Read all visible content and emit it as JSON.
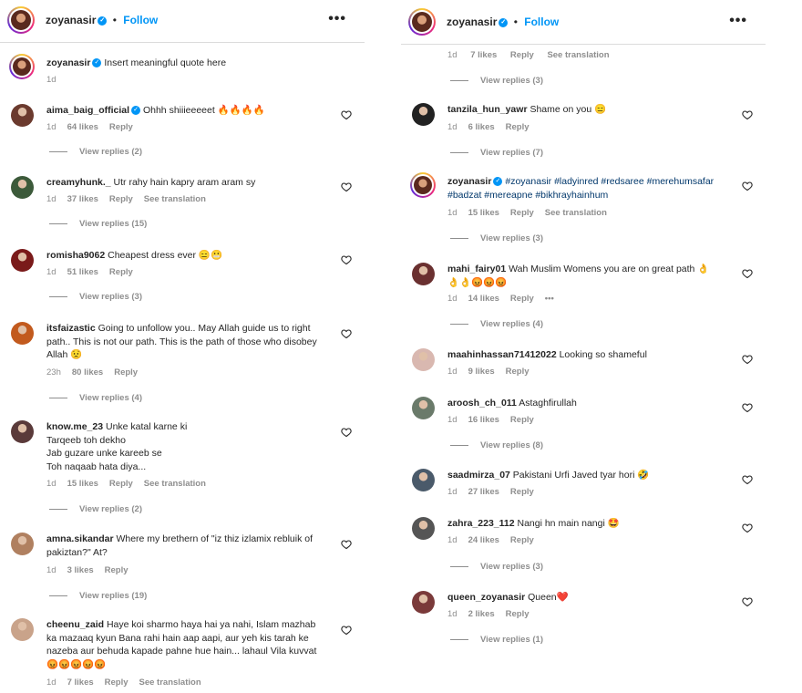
{
  "left": {
    "header": {
      "username": "zoyanasir",
      "dot": "•",
      "follow": "Follow"
    },
    "caption": {
      "username": "zoyanasir",
      "text": "Insert meaningful quote here",
      "time": "1d"
    },
    "comments": [
      {
        "user": "aima_baig_official",
        "verified": true,
        "text": "Ohhh shiiieeeeet 🔥🔥🔥🔥",
        "time": "1d",
        "likes": "64 likes",
        "reply": "Reply",
        "translation": "",
        "view_replies": "View replies (2)",
        "avatar_color": "#6b3a2e"
      },
      {
        "user": "creamyhunk._",
        "text": "Utr rahy hain kapry aram aram sy",
        "time": "1d",
        "likes": "37 likes",
        "reply": "Reply",
        "translation": "See translation",
        "view_replies": "View replies (15)",
        "avatar_color": "#3c5a3a"
      },
      {
        "user": "romisha9062",
        "text": "Cheapest dress ever 😑😬",
        "time": "1d",
        "likes": "51 likes",
        "reply": "Reply",
        "translation": "",
        "view_replies": "View replies (3)",
        "avatar_color": "#7a1a1a"
      },
      {
        "user": "itsfaizastic",
        "text": "Going to unfollow you.. May Allah guide us to right path.. This is not our path. This is the path of those who disobey Allah 😟",
        "time": "23h",
        "likes": "80 likes",
        "reply": "Reply",
        "translation": "",
        "view_replies": "View replies (4)",
        "avatar_color": "#c25a1e"
      },
      {
        "user": "know.me_23",
        "text": "Unke katal karne ki\nTarqeeb toh dekho\nJab guzare unke kareeb se\nToh naqaab hata diya...",
        "time": "1d",
        "likes": "15 likes",
        "reply": "Reply",
        "translation": "See translation",
        "view_replies": "View replies (2)",
        "avatar_color": "#5a3a3a"
      },
      {
        "user": "amna.sikandar",
        "text": "Where my brethern of \"iz thiz izlamix rebluik of pakiztan?\" At?",
        "time": "1d",
        "likes": "3 likes",
        "reply": "Reply",
        "translation": "",
        "view_replies": "View replies (19)",
        "avatar_color": "#b08060"
      },
      {
        "user": "cheenu_zaid",
        "text": "Haye koi sharmo haya hai ya nahi, Islam mazhab ka mazaaq kyun Bana rahi hain aap aapi, aur yeh kis tarah ke nazeba aur behuda kapade pahne hue hain... lahaul Vila kuvvat 😡😡😡😡😡",
        "time": "1d",
        "likes": "7 likes",
        "reply": "Reply",
        "translation": "See translation",
        "view_replies": "",
        "avatar_color": "#c9a38a"
      }
    ]
  },
  "right": {
    "header": {
      "username": "zoyanasir",
      "dot": "•",
      "follow": "Follow"
    },
    "top_meta": {
      "time": "1d",
      "likes": "7 likes",
      "reply": "Reply",
      "translation": "See translation",
      "view_replies": "View replies (3)"
    },
    "comments": [
      {
        "user": "tanzila_hun_yawr",
        "text": "Shame on you 😑",
        "time": "1d",
        "likes": "6 likes",
        "reply": "Reply",
        "translation": "",
        "view_replies": "View replies (7)",
        "avatar_color": "#222222"
      },
      {
        "user": "zoyanasir",
        "verified": true,
        "text": "#zoyanasir #ladyinred #redsaree #merehumsafar #badzat #mereapne #bikhrayhainhum",
        "time": "1d",
        "likes": "15 likes",
        "reply": "Reply",
        "translation": "See translation",
        "view_replies": "View replies (3)",
        "avatar_color": "ring"
      },
      {
        "user": "mahi_fairy01",
        "text": "Wah Muslim Womens you are on great path 👌👌👌😡😡😡",
        "time": "1d",
        "likes": "14 likes",
        "reply": "Reply",
        "translation": "",
        "more": "•••",
        "view_replies": "View replies (4)",
        "avatar_color": "#6a3030"
      },
      {
        "user": "maahinhassan71412022",
        "text": "Looking so shameful",
        "time": "1d",
        "likes": "9 likes",
        "reply": "Reply",
        "translation": "",
        "view_replies": "",
        "avatar_color": "#d9b8b0"
      },
      {
        "user": "aroosh_ch_011",
        "text": "Astaghfirullah",
        "time": "1d",
        "likes": "16 likes",
        "reply": "Reply",
        "translation": "",
        "view_replies": "View replies (8)",
        "avatar_color": "#6a7a6a"
      },
      {
        "user": "saadmirza_07",
        "text": "Pakistani Urfi Javed tyar hori 🤣",
        "time": "1d",
        "likes": "27 likes",
        "reply": "Reply",
        "translation": "",
        "view_replies": "",
        "avatar_color": "#4a5a6a"
      },
      {
        "user": "zahra_223_112",
        "text": "Nangi hn main nangi 🤩",
        "time": "1d",
        "likes": "24 likes",
        "reply": "Reply",
        "translation": "",
        "view_replies": "View replies (3)",
        "avatar_color": "#555555"
      },
      {
        "user": "queen_zoyanasir",
        "text": "Queen❤️",
        "time": "1d",
        "likes": "2 likes",
        "reply": "Reply",
        "translation": "",
        "view_replies": "View replies (1)",
        "avatar_color": "#7a3a3a"
      }
    ]
  }
}
